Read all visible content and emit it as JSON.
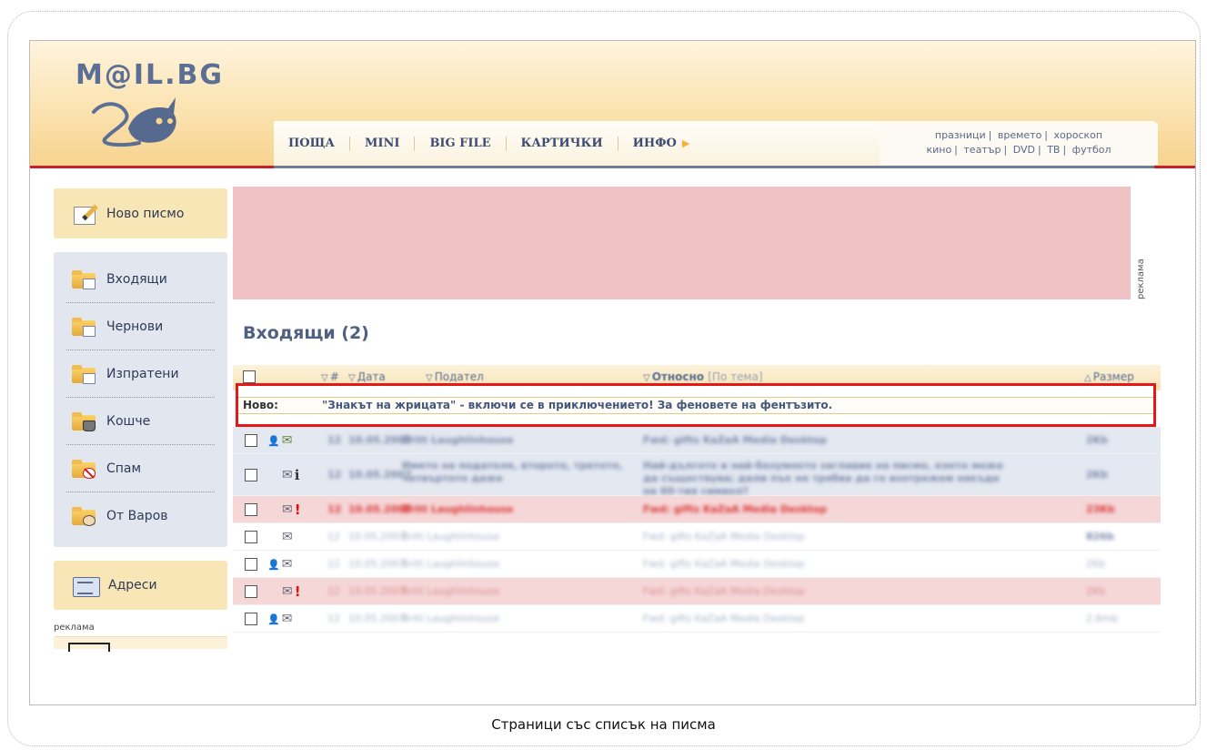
{
  "logo": {
    "text": "M@IL.BG"
  },
  "menu": [
    {
      "label": "ПОЩА"
    },
    {
      "label": "MINI"
    },
    {
      "label": "BIG FILE"
    },
    {
      "label": "КАРТИЧКИ"
    },
    {
      "label": "ИНФО"
    }
  ],
  "quick_links": {
    "row1": [
      "празници",
      "времето",
      "хороскоп"
    ],
    "row2": [
      "кино",
      "театър",
      "DVD",
      "ТВ",
      "футбол"
    ]
  },
  "sidebar": {
    "new_message": "Ново писмо",
    "folders": [
      {
        "label": "Входящи",
        "icon": "inbox-folder-icon"
      },
      {
        "label": "Чернови",
        "icon": "drafts-folder-icon"
      },
      {
        "label": "Изпратени",
        "icon": "sent-folder-icon"
      },
      {
        "label": "Кошче",
        "icon": "trash-folder-icon"
      },
      {
        "label": "Спам",
        "icon": "spam-folder-icon"
      },
      {
        "label": "От Варов",
        "icon": "custom-folder-icon"
      }
    ],
    "addresses": "Адреси",
    "ad_label": "реклама"
  },
  "ad_banner": {
    "label": "реклама",
    "color": "#f1c2c3"
  },
  "page_title": "Входящи (2)",
  "table": {
    "headers": {
      "num": "#",
      "date": "Дата",
      "from": "Подател",
      "subject": "Относно",
      "subject_link": "По тема",
      "size": "Размер"
    },
    "new_row": {
      "label": "Ново:",
      "text": "\"Знакът на жрицата\" - включи се в приключението! За феновете на фентъзито."
    },
    "rows": [
      {
        "num": "12",
        "date": "10.05.2007",
        "from": "Britt Laughlinhouse",
        "subject": "Fwd: gifts KaZaA Media Desktop",
        "size": "2Kb"
      },
      {
        "num": "12",
        "date": "10.05.2007",
        "from": "Името на подателя, второто, третото, четвъртото даже",
        "subject": "Най-дългото и най-безумното заглавие на писмо, което може да съществува; дали пък не трябва да го изотрежем някъде на 60-тия символ?",
        "size": "2Kb"
      },
      {
        "num": "12",
        "date": "10.05.2007",
        "from": "Britt Laughlinhouse",
        "subject": "Fwd: gifts KaZaA Media Desktop",
        "size": "23Kb"
      },
      {
        "num": "12",
        "date": "10.05.2007",
        "from": "Britt Laughlinhouse",
        "subject": "Fwd: gifts KaZaA Media Desktop",
        "size": "826b"
      },
      {
        "num": "12",
        "date": "10.05.2007",
        "from": "Britt Laughlinhouse",
        "subject": "Fwd: gifts KaZaA Media Desktop",
        "size": "2Kb"
      },
      {
        "num": "12",
        "date": "10.05.2007",
        "from": "Britt Laughlinhouse",
        "subject": "Fwd: gifts KaZaA Media Desktop",
        "size": "2Kb"
      },
      {
        "num": "12",
        "date": "10.05.2007",
        "from": "Britt Laughlinhouse",
        "subject": "Fwd: gifts KaZaA Media Desktop",
        "size": "2.6mb"
      }
    ]
  },
  "caption": "Страници със списък на писма",
  "colors": {
    "accent_red": "#c8202b",
    "highlight_red": "#e41818",
    "title_blue": "#4f6081"
  }
}
